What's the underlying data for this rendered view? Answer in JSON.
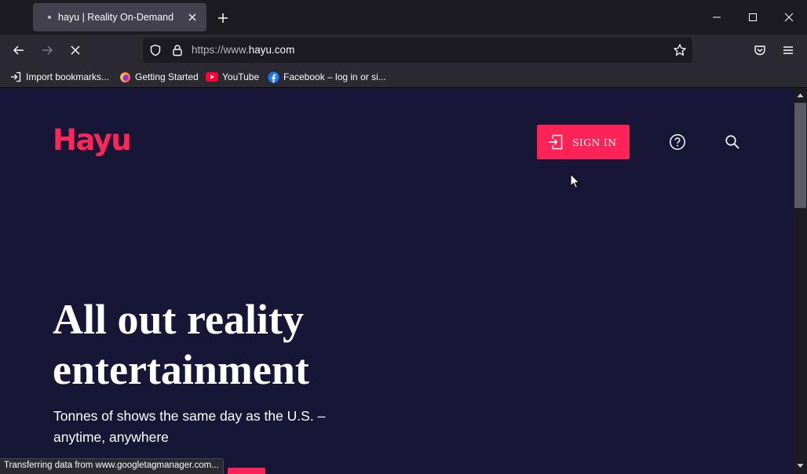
{
  "browser": {
    "tab": {
      "title": "hayu | Reality On-Demand"
    },
    "url": {
      "prefix": "https://www.",
      "domain": "hayu.com"
    },
    "bookmarks": [
      {
        "label": "Import bookmarks...",
        "icon": "import-icon"
      },
      {
        "label": "Getting Started",
        "icon": "firefox-icon"
      },
      {
        "label": "YouTube",
        "icon": "youtube-icon"
      },
      {
        "label": "Facebook – log in or si...",
        "icon": "facebook-icon"
      }
    ],
    "status": "Transferring data from www.googletagmanager.com..."
  },
  "page": {
    "logo": "Hayu",
    "signin_label": "SIGN IN",
    "hero": {
      "title_line1": "All out reality",
      "title_line2": "entertainment",
      "subtitle_line1": "Tonnes of shows the same day as the U.S. –",
      "subtitle_line2": "anytime, anywhere"
    }
  },
  "colors": {
    "brand": "#f9275a",
    "cta": "#fd2359",
    "page_bg": "#171637",
    "chrome_bg": "#2b2a33",
    "tabstrip_bg": "#1c1b22"
  }
}
